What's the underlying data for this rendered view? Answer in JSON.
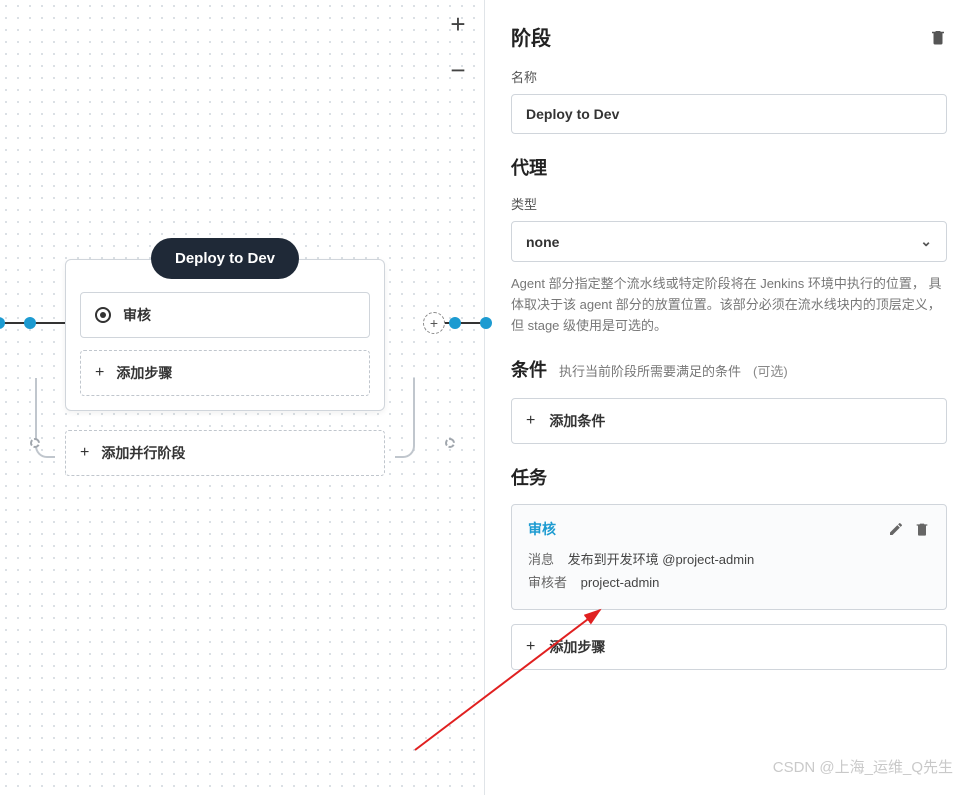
{
  "canvas": {
    "stage_title": "Deploy to Dev",
    "step": {
      "label": "审核"
    },
    "add_step": "添加步骤",
    "add_parallel": "添加并行阶段",
    "zoom_in": "+",
    "zoom_out": "−"
  },
  "panel": {
    "stage": {
      "title": "阶段",
      "name_label": "名称",
      "name_value": "Deploy to Dev"
    },
    "agent": {
      "title": "代理",
      "type_label": "类型",
      "type_value": "none",
      "help": "Agent 部分指定整个流水线或特定阶段将在 Jenkins 环境中执行的位置， 具体取决于该 agent 部分的放置位置。该部分必须在流水线块内的顶层定义， 但 stage 级使用是可选的。"
    },
    "conditions": {
      "title": "条件",
      "desc": "执行当前阶段所需要满足的条件",
      "optional": "(可选)",
      "add": "添加条件"
    },
    "tasks": {
      "title": "任务",
      "card": {
        "name": "审核",
        "message_label": "消息",
        "message_value": "发布到开发环境 @project-admin",
        "reviewer_label": "审核者",
        "reviewer_value": "project-admin"
      },
      "add": "添加步骤"
    }
  },
  "watermark": "CSDN @上海_运维_Q先生"
}
